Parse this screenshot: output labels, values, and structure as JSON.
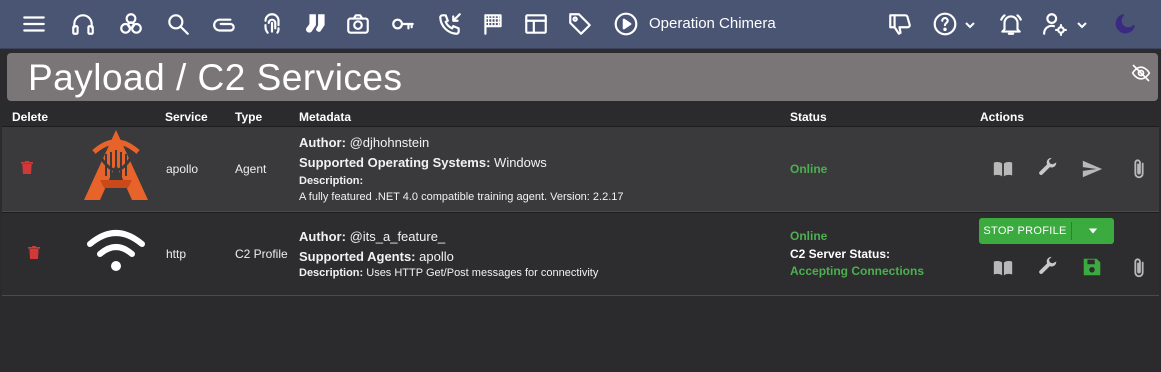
{
  "nav": {
    "operation_name": "Operation Chimera",
    "icons": [
      "menu-icon",
      "headphones-icon",
      "biohazard-icon",
      "search-icon",
      "paperclip-icon",
      "fingerprint-icon",
      "socks-icon",
      "camera-icon",
      "key-icon",
      "phone-incoming-icon",
      "checkered-flag-icon",
      "table-layout-icon",
      "tag-icon",
      "play-circle-icon",
      "thumbs-down-icon",
      "help-icon",
      "alarm-bell-icon",
      "user-settings-icon",
      "moon-icon"
    ]
  },
  "banner": {
    "title": "Payload / C2 Services"
  },
  "table": {
    "headers": {
      "delete": "Delete",
      "service": "Service",
      "type": "Type",
      "metadata": "Metadata",
      "status": "Status",
      "actions": "Actions"
    },
    "rows": [
      {
        "service": "apollo",
        "type": "Agent",
        "author_label": "Author:",
        "author": "@djhohnstein",
        "os_label": "Supported Operating Systems:",
        "os": "Windows",
        "desc_label": "Description:",
        "description": "A fully featured .NET 4.0 compatible training agent. Version: 2.2.17",
        "status": "Online"
      },
      {
        "service": "http",
        "type": "C2 Profile",
        "author_label": "Author:",
        "author": "@its_a_feature_",
        "agents_label": "Supported Agents:",
        "agents": "apollo",
        "desc_label": "Description:",
        "description": "Uses HTTP Get/Post messages for connectivity",
        "status": "Online",
        "c2_status_label": "C2 Server Status:",
        "c2_status": "Accepting Connections",
        "stop_button": "STOP PROFILE"
      }
    ]
  },
  "colors": {
    "nav_bg": "#4a5573",
    "banner_bg": "#7a7678",
    "online": "#4caf50",
    "danger": "#d13838",
    "apollo_orange": "#e8632a",
    "stop_button": "#3bab3f"
  }
}
